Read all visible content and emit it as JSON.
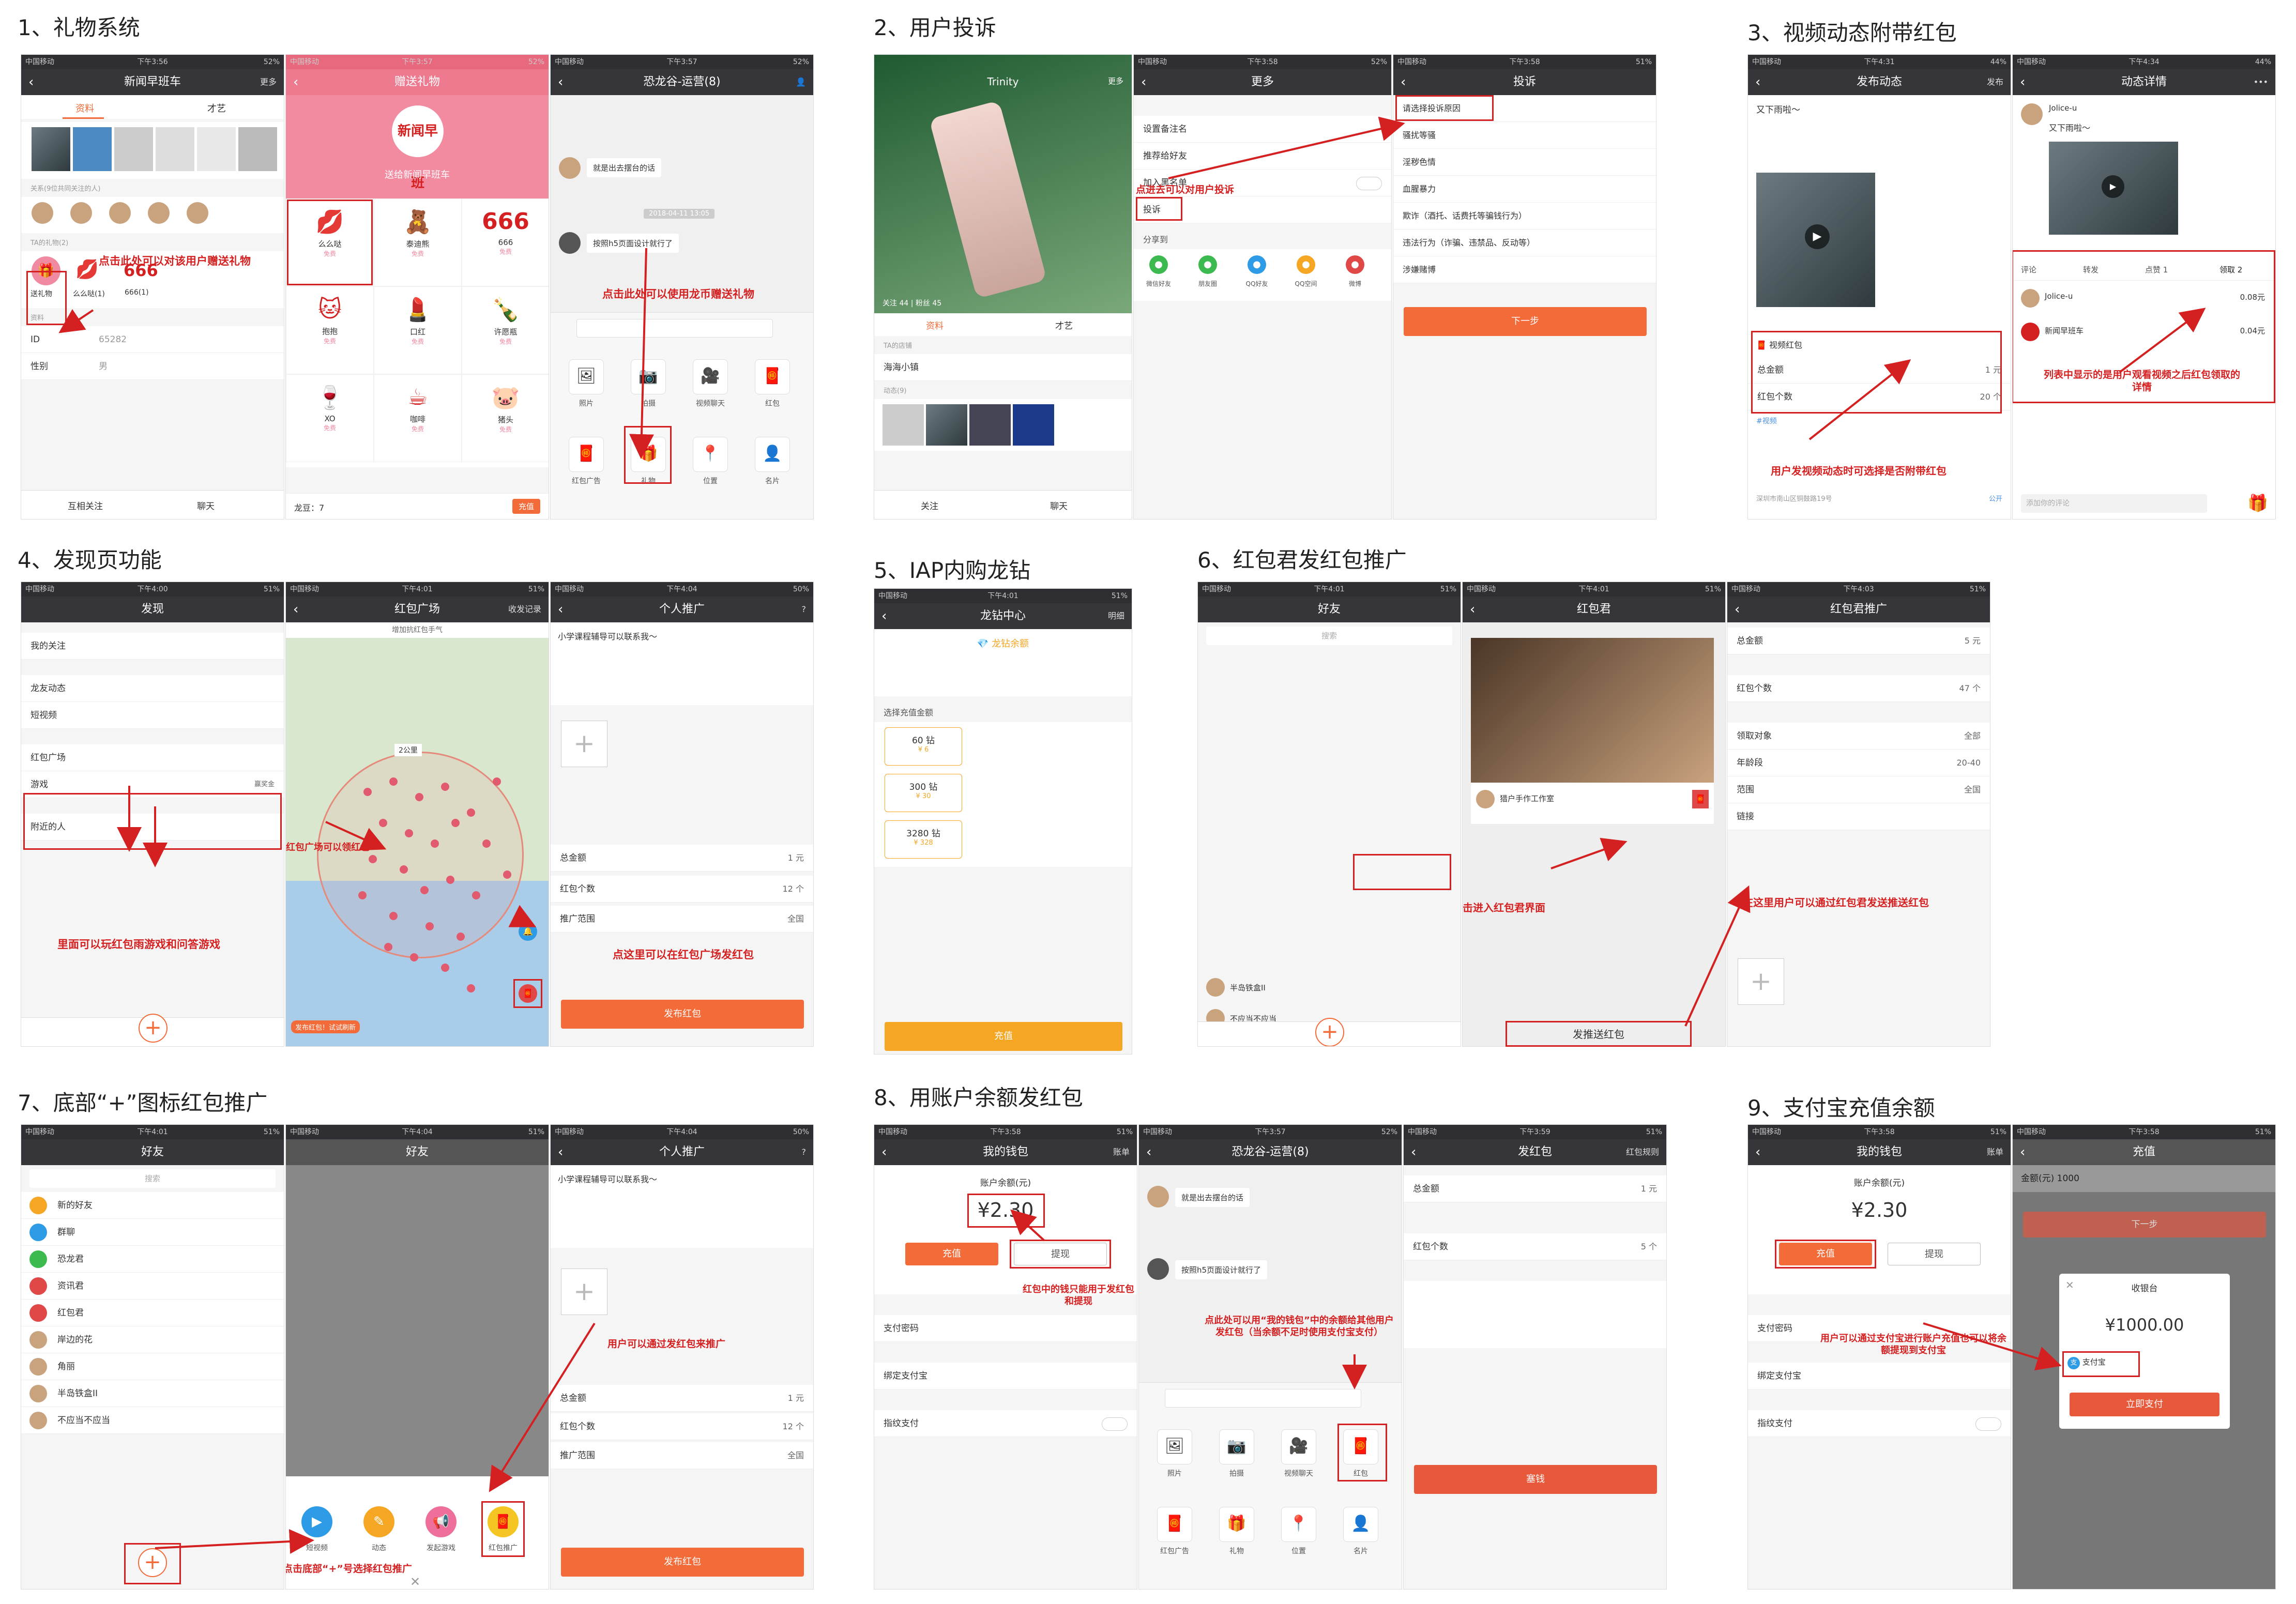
{
  "sections": [
    {
      "title": "1、礼物系统"
    },
    {
      "title": "2、用户投诉"
    },
    {
      "title": "3、视频动态附带红包"
    },
    {
      "title": "4、发现页功能"
    },
    {
      "title": "5、IAP内购龙钻"
    },
    {
      "title": "6、红包君发红包推广"
    },
    {
      "title": "7、底部“+”图标红包推广"
    },
    {
      "title": "8、用账户余额发红包"
    },
    {
      "title": "9、支付宝充值余额"
    }
  ],
  "s1": {
    "p1": {
      "time": "下午3:56",
      "title": "新闻早班车",
      "more": "更多",
      "tab1": "资料",
      "tab2": "才艺",
      "rel": "关系(9位共同关注的人)",
      "gifts_label": "TA的礼物(2)",
      "gift_send": "送礼物",
      "gift2": "么么哒(1)",
      "gift3": "666(1)",
      "info": "资料",
      "id_label": "ID",
      "id_val": "65282",
      "sex_label": "性别",
      "sex_val": "男",
      "btn_follow": "互相关注",
      "btn_chat": "聊天",
      "ann": "点击此处可以对该用户赠送礼物"
    },
    "p2": {
      "time": "下午3:57",
      "title": "赠送礼物",
      "logo": "新闻早班",
      "sub": "送给新闻早班车",
      "gifts": [
        {
          "n": "么么哒",
          "p": "免费"
        },
        {
          "n": "泰迪熊",
          "p": "免费"
        },
        {
          "n": "666",
          "p": "免费"
        },
        {
          "n": "抱抱",
          "p": "免费"
        },
        {
          "n": "口红",
          "p": "免费"
        },
        {
          "n": "许愿瓶",
          "p": "免费"
        },
        {
          "n": "XO",
          "p": "免费"
        },
        {
          "n": "咖啡",
          "p": "免费"
        },
        {
          "n": "猪头",
          "p": "免费"
        }
      ],
      "balance": "龙豆：7",
      "recharge": "充值"
    },
    "p3": {
      "time": "下午3:57",
      "title": "恐龙谷-运营(8)",
      "msg1": "就是出去摆台的话",
      "date": "2018-04-11 13:05",
      "msg2": "按照h5页面设计就行了",
      "tools": [
        "照片",
        "拍摄",
        "视频聊天",
        "红包",
        "红包广告",
        "礼物",
        "位置",
        "名片"
      ],
      "ann": "点击此处可以使用龙币赠送礼物"
    }
  },
  "s2": {
    "p1": {
      "name": "Trinity",
      "more": "更多",
      "tab1": "资料",
      "tab2": "才艺",
      "stats": "关注 44 | 粉丝 45",
      "shop": "TA的店铺",
      "shop_name": "海海小镇",
      "dyn": "动态(9)",
      "btn_follow": "关注",
      "btn_chat": "聊天"
    },
    "p2": {
      "title": "更多",
      "rows": [
        "设置备注名",
        "推荐给好友",
        "加入黑名单",
        "投诉"
      ],
      "share": "分享到",
      "share_items": [
        "微信好友",
        "朋友圈",
        "QQ好友",
        "QQ空间",
        "微博"
      ],
      "ann": "点进去可以对用户投诉"
    },
    "p3": {
      "title": "投诉",
      "head": "请选择投诉原因",
      "reasons": [
        "骚扰等骚",
        "淫秽色情",
        "血腥暴力",
        "欺诈（酒托、话费托等骗钱行为）",
        "违法行为（诈骗、违禁品、反动等）",
        "涉嫌赌博"
      ],
      "next": "下一步"
    }
  },
  "s3": {
    "p1": {
      "time": "下午4:31",
      "title": "发布动态",
      "publish": "发布",
      "text": "又下雨啦～",
      "rp": "视频红包",
      "total_label": "总金额",
      "total_val": "1 元",
      "count_label": "红包个数",
      "count_val": "20 个",
      "tag": "#视频",
      "loc": "深圳市南山区铜鼓路19号",
      "pub": "公开",
      "ann": "用户发视频动态时可选择是否附带红包"
    },
    "p2": {
      "time": "下午4:34",
      "title": "动态详情",
      "user": "Jolice-u",
      "text": "又下雨啦～",
      "tabs": [
        "评论",
        "转发",
        "点赞 1",
        "领取 2"
      ],
      "r1n": "Jolice-u",
      "r1v": "0.08元",
      "r2n": "新闻早班车",
      "r2v": "0.04元",
      "comment": "添加你的评论",
      "ann": "列表中显示的是用户观看视频之后红包领取的详情"
    }
  },
  "s4": {
    "p1": {
      "time": "下午4:00",
      "title": "发现",
      "rows": [
        "我的关注",
        "龙友动态",
        "短视频",
        "红包广场",
        "游戏",
        "附近的人"
      ],
      "game_tag": "赢奖金",
      "ann1": "里面可以玩红包雨游戏和问答游戏"
    },
    "p2": {
      "title": "红包广场",
      "record": "收发记录",
      "top": "增加抗红包手气",
      "scale": "2公里",
      "ann": "红包广场可以领红包",
      "ann2": "点这里可以在红包广场发红包",
      "chip": "发布红包！试试刷新"
    },
    "p3": {
      "time": "下午4:04",
      "title": "个人推广",
      "text": "小学课程辅导可以联系我～",
      "total_label": "总金额",
      "total_val": "1 元",
      "count_label": "红包个数",
      "count_val": "12 个",
      "range_label": "推广范围",
      "range_val": "全国",
      "btn": "发布红包"
    }
  },
  "s5": {
    "p1": {
      "time": "下午4:01",
      "title": "龙钻中心",
      "detail": "明细",
      "balance": "龙钻余额",
      "choose": "选择充值金额",
      "opts": [
        {
          "d": "60 钻",
          "p": "¥ 6"
        },
        {
          "d": "300 钻",
          "p": "¥ 30"
        },
        {
          "d": "3280 钻",
          "p": "¥ 328"
        }
      ],
      "btn": "充值"
    }
  },
  "s6": {
    "p1": {
      "time": "下午4:01",
      "title": "好友",
      "search": "搜索",
      "f1": "半岛铁盒II",
      "f2": "不应当不应当"
    },
    "p2": {
      "time": "下午4:01",
      "title": "红包君",
      "shop": "猎户手作工作室",
      "ann": "点击进入红包君界面"
    },
    "p3": {
      "time": "下午4:03",
      "title": "红包君推广",
      "total_label": "总金额",
      "total_val": "5 元",
      "count_label": "红包个数",
      "count_val": "47 个",
      "target_label": "领取对象",
      "target_val": "全部",
      "age_label": "年龄段",
      "age_val": "20-40",
      "range_label": "范围",
      "range_val": "全国",
      "link_label": "链接",
      "ann": "在这里用户可以通过红包君发送推送红包",
      "btn": "发推送红包"
    }
  },
  "s7": {
    "p1": {
      "time": "下午4:01",
      "title": "好友",
      "search": "搜索",
      "rows": [
        "新的好友",
        "群聊",
        "恐龙君",
        "资讯君",
        "红包君",
        "岸边的花",
        "角丽",
        "半岛铁盒II",
        "不应当不应当"
      ]
    },
    "p2": {
      "time": "下午4:04",
      "title": "好友",
      "menu": [
        "短视频",
        "动态",
        "发起游戏",
        "红包推广"
      ],
      "ann": "用户可以通过点击底部“+”号选择红包推广"
    },
    "p3": {
      "time": "下午4:04",
      "title": "个人推广",
      "text": "小学课程辅导可以联系我～",
      "total_label": "总金额",
      "total_val": "1 元",
      "count_label": "红包个数",
      "count_val": "12 个",
      "range_label": "推广范围",
      "range_val": "全国",
      "btn": "发布红包",
      "ann": "用户可以通过发红包来推广"
    }
  },
  "s8": {
    "p1": {
      "time": "下午3:58",
      "title": "我的钱包",
      "bill": "账单",
      "bal_label": "账户余额(元)",
      "bal": "¥2.30",
      "recharge": "充值",
      "withdraw": "提现",
      "rows": [
        "支付密码",
        "绑定支付宝",
        "指纹支付"
      ],
      "ann": "红包中的钱只能用于发红包和提现"
    },
    "p2": {
      "time": "下午3:57",
      "title": "恐龙谷-运营(8)",
      "msg1": "就是出去摆台的话",
      "msg2": "按照h5页面设计就行了",
      "tools": [
        "照片",
        "拍摄",
        "视频聊天",
        "红包",
        "红包广告",
        "礼物",
        "位置",
        "名片"
      ],
      "ann": "点此处可以用“我的钱包”中的余额给其他用户发红包（当余额不足时使用支付宝支付）"
    },
    "p3": {
      "time": "下午3:59",
      "title": "发红包",
      "rule": "红包规则",
      "total_label": "总金额",
      "total_val": "1 元",
      "count_label": "红包个数",
      "count_val": "5 个",
      "btn": "塞钱"
    }
  },
  "s9": {
    "p1": {
      "time": "下午3:58",
      "title": "我的钱包",
      "bill": "账单",
      "bal_label": "账户余额(元)",
      "bal": "¥2.30",
      "recharge": "充值",
      "withdraw": "提现",
      "rows": [
        "支付密码",
        "绑定支付宝",
        "指纹支付"
      ],
      "ann": "用户可以通过支付宝进行账户充值也可以将余额提现到支付宝"
    },
    "p2": {
      "time": "下午3:58",
      "title": "充值",
      "amount": "金额(元)  1000",
      "next": "下一步",
      "cashier": "收银台",
      "price": "¥1000.00",
      "method": "支付宝",
      "pay": "立即支付"
    }
  },
  "colors": {
    "accent": "#f26b38",
    "annotation": "#d42020",
    "nav": "#35353a"
  }
}
